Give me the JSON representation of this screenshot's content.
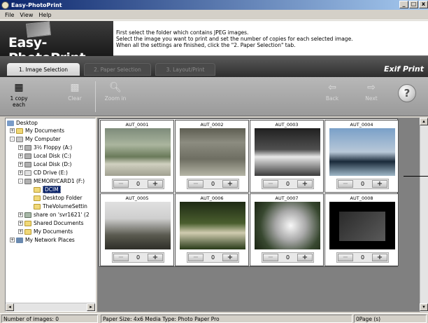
{
  "window": {
    "title": "Easy-PhotoPrint",
    "buttons": [
      "_",
      "□",
      "x"
    ]
  },
  "menu": [
    "File",
    "View",
    "Help"
  ],
  "banner": {
    "logo": "Easy-PhotoPrint",
    "instructions": [
      "First select the folder which contains JPEG images.",
      "Select the image you want to print and set the number of copies for each selected image.",
      "When all the settings are finished, click the \"2. Paper Selection\" tab."
    ]
  },
  "tabs": [
    {
      "label": "1. Image Selection",
      "state": "active"
    },
    {
      "label": "2. Paper Selection",
      "state": "disabled"
    },
    {
      "label": "3. Layout/Print",
      "state": "disabled"
    }
  ],
  "exif_logo": "Exif Print",
  "toolbar": {
    "one_copy_line1": "1 copy",
    "one_copy_line2": "each",
    "clear": "Clear",
    "zoom_in": "Zoom in",
    "back": "Back",
    "next": "Next",
    "help": "?"
  },
  "tree": [
    {
      "label": "Desktop",
      "icon": "desktop-icon"
    },
    {
      "label": "My Documents",
      "icon": "folder-icon",
      "expander": "+"
    },
    {
      "label": "My Computer",
      "icon": "computer-icon",
      "expander": "-"
    },
    {
      "label": "3½ Floppy (A:)",
      "icon": "floppy-icon",
      "expander": "+"
    },
    {
      "label": "Local Disk (C:)",
      "icon": "drive-icon",
      "expander": "+"
    },
    {
      "label": "Local Disk (D:)",
      "icon": "drive-icon",
      "expander": "+"
    },
    {
      "label": "CD Drive (E:)",
      "icon": "cd-icon",
      "expander": "+"
    },
    {
      "label": "MEMORYCARD1 (F:)",
      "icon": "drive-icon",
      "expander": "-"
    },
    {
      "label": "DCIM",
      "icon": "folder-icon",
      "selected": true
    },
    {
      "label": "Desktop Folder",
      "icon": "folder-icon"
    },
    {
      "label": "TheVolumeSettin",
      "icon": "folder-icon"
    },
    {
      "label": "share on 'svr1621' (2",
      "icon": "network-drive-icon",
      "expander": "+"
    },
    {
      "label": "Shared Documents",
      "icon": "folder-icon",
      "expander": "+"
    },
    {
      "label": "My Documents",
      "icon": "folder-icon",
      "expander": "+"
    },
    {
      "label": "My Network Places",
      "icon": "network-icon",
      "expander": "+"
    }
  ],
  "thumbnails": [
    {
      "name": "AUT_0001",
      "copies": "0"
    },
    {
      "name": "AUT_0002",
      "copies": "0"
    },
    {
      "name": "AUT_0003",
      "copies": "0"
    },
    {
      "name": "AUT_0004",
      "copies": "0"
    },
    {
      "name": "AUT_0005",
      "copies": "0"
    },
    {
      "name": "AUT_0006",
      "copies": "0"
    },
    {
      "name": "AUT_0007",
      "copies": "0"
    },
    {
      "name": "AUT_0008",
      "copies": "0"
    }
  ],
  "counter": {
    "minus": "−",
    "plus": "+"
  },
  "status": {
    "count": "Number of images: 0",
    "paper": "Paper Size: 4x6 Media Type: Photo Paper Pro",
    "pages": "0Page (s)"
  }
}
